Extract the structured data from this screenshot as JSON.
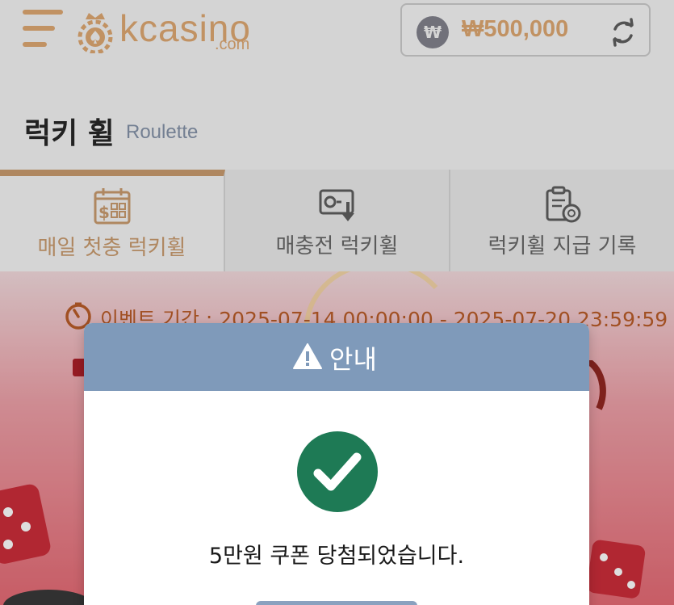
{
  "header": {
    "logo_text": "kcasino",
    "logo_sub": ".com",
    "currency_symbol": "₩",
    "balance": "₩500,000"
  },
  "page": {
    "title": "럭키 휠",
    "subtitle": "Roulette"
  },
  "tabs": [
    {
      "label": "매일 첫충 럭키휠",
      "icon": "calendar-dollar-icon",
      "active": true
    },
    {
      "label": "매충전 럭키휠",
      "icon": "deposit-icon",
      "active": false
    },
    {
      "label": "럭키휠 지급 기록",
      "icon": "clipboard-history-icon",
      "active": false
    }
  ],
  "event": {
    "period_text": "이벤트 기간 : 2025-07-14 00:00:00 - 2025-07-20 23:59:59"
  },
  "modal": {
    "title": "안내",
    "message": "5만원 쿠폰 당첨되었습니다."
  },
  "colors": {
    "accent_gold": "#dca36a",
    "tab_active": "#c69566",
    "modal_header": "#7f9aba",
    "success_green": "#1e7a55"
  }
}
